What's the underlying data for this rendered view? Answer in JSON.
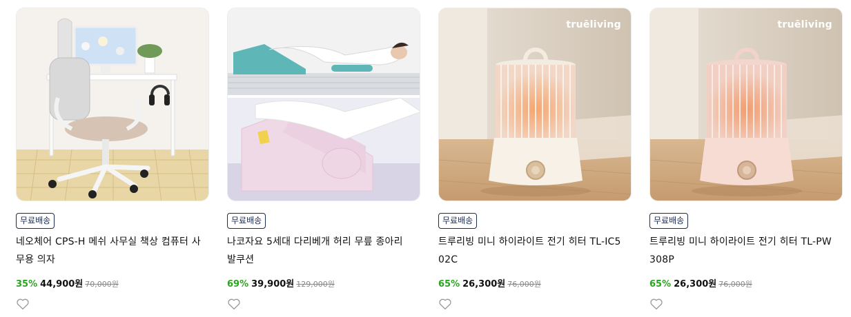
{
  "products": [
    {
      "shipping_badge": "무료배송",
      "title": "네오체어 CPS-H 메쉬 사무실 책상 컴퓨터 사무용 의자",
      "discount": "35%",
      "price": "44,900원",
      "original_price": "70,000원",
      "image": "office-chair-desk"
    },
    {
      "shipping_badge": "무료배송",
      "title": "나코자요 5세대 다리베개 허리 무릎 종아리 발쿠션",
      "discount": "69%",
      "price": "39,900원",
      "original_price": "129,000원",
      "image": "leg-pillow-cushion"
    },
    {
      "shipping_badge": "무료배송",
      "title": "트루리빙 미니 하이라이트 전기 히터 TL-IC502C",
      "discount": "65%",
      "price": "26,300원",
      "original_price": "76,000원",
      "image": "mini-heater-ivory",
      "brand_logo": "truēliving"
    },
    {
      "shipping_badge": "무료배송",
      "title": "트루리빙 미니 하이라이트 전기 히터 TL-PW308P",
      "discount": "65%",
      "price": "26,300원",
      "original_price": "76,000원",
      "image": "mini-heater-pink",
      "brand_logo": "truēliving"
    }
  ],
  "colors": {
    "discount": "#2ba521",
    "badge_border": "#1a2a52",
    "heater_body_ivory": "#f7f1e8",
    "heater_body_pink": "#f7dcd3"
  },
  "icons": {
    "wishlist": "heart-outline-icon"
  }
}
